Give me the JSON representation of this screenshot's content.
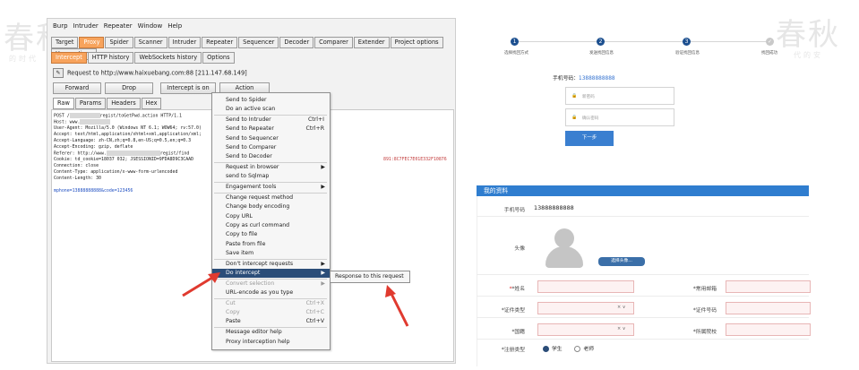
{
  "watermark": {
    "left_big": "春秋",
    "left_small": "的时代",
    "right_big": "春秋",
    "right_small": "代的安"
  },
  "burp": {
    "menu": [
      "Burp",
      "Intruder",
      "Repeater",
      "Window",
      "Help"
    ],
    "main_tabs": [
      "Target",
      "Proxy",
      "Spider",
      "Scanner",
      "Intruder",
      "Repeater",
      "Sequencer",
      "Decoder",
      "Comparer",
      "Extender",
      "Project options",
      "User options"
    ],
    "proxy_tabs": [
      "Intercept",
      "HTTP history",
      "WebSockets history",
      "Options"
    ],
    "request_line": "Request to http://www.haixuebang.com:88  [211.147.68.149]",
    "pencil_icon": "pencil-icon",
    "buttons": {
      "forward": "Forward",
      "drop": "Drop",
      "intercept": "Intercept is on",
      "action": "Action"
    },
    "editor_tabs": [
      "Raw",
      "Params",
      "Headers",
      "Hex"
    ],
    "request_lines": [
      "POST /",
      "Host: www.",
      "User-Agent: Mozilla/5.0 (Windows NT 6.1; WOW64; rv:57.0)",
      "Accept: text/html,application/xhtml+xml,application/xml;",
      "Accept-Language: zh-CN,zh;q=0.8,en-US;q=0.5,en;q=0.3",
      "Accept-Encoding: gzip, deflate",
      "Referer: http://www.",
      "Cookie: td_cookie=18037 032; JSESSIONID=9FDA8D9C3CAAD",
      "Connection: close",
      "Content-Type: application/x-www-form-urlencoded",
      "Content-Length: 30",
      "",
      "mphone=13888888888&code=123456"
    ],
    "request_path": "regist/toGetPwd.action HTTP/1.1",
    "referer_path": "regist/find",
    "cookie_tail": "891:8C7FEC7E01E332F10876"
  },
  "context_menu": [
    {
      "label": "Send to Spider",
      "shortcut": "",
      "arrow": false,
      "disabled": false
    },
    {
      "label": "Do an active scan",
      "shortcut": "",
      "arrow": false,
      "disabled": false
    },
    {
      "label": "Send to Intruder",
      "shortcut": "Ctrl+I",
      "arrow": false,
      "disabled": false
    },
    {
      "label": "Send to Repeater",
      "shortcut": "Ctrl+R",
      "arrow": false,
      "disabled": false
    },
    {
      "label": "Send to Sequencer",
      "shortcut": "",
      "arrow": false,
      "disabled": false
    },
    {
      "label": "Send to Comparer",
      "shortcut": "",
      "arrow": false,
      "disabled": false
    },
    {
      "label": "Send to Decoder",
      "shortcut": "",
      "arrow": false,
      "disabled": false
    },
    {
      "label": "Request in browser",
      "shortcut": "",
      "arrow": true,
      "disabled": false
    },
    {
      "label": "send to Sqlmap",
      "shortcut": "",
      "arrow": false,
      "disabled": false
    },
    {
      "label": "Engagement tools",
      "shortcut": "",
      "arrow": true,
      "disabled": false
    },
    {
      "label": "Change request method",
      "shortcut": "",
      "arrow": false,
      "disabled": false
    },
    {
      "label": "Change body encoding",
      "shortcut": "",
      "arrow": false,
      "disabled": false
    },
    {
      "label": "Copy URL",
      "shortcut": "",
      "arrow": false,
      "disabled": false
    },
    {
      "label": "Copy as curl command",
      "shortcut": "",
      "arrow": false,
      "disabled": false
    },
    {
      "label": "Copy to file",
      "shortcut": "",
      "arrow": false,
      "disabled": false
    },
    {
      "label": "Paste from file",
      "shortcut": "",
      "arrow": false,
      "disabled": false
    },
    {
      "label": "Save item",
      "shortcut": "",
      "arrow": false,
      "disabled": false
    },
    {
      "label": "Don't intercept requests",
      "shortcut": "",
      "arrow": true,
      "disabled": false
    },
    {
      "label": "Do intercept",
      "shortcut": "",
      "arrow": true,
      "disabled": false,
      "highlight": true
    },
    {
      "label": "Convert selection",
      "shortcut": "",
      "arrow": true,
      "disabled": true
    },
    {
      "label": "URL-encode as you type",
      "shortcut": "",
      "arrow": false,
      "disabled": false
    },
    {
      "label": "Cut",
      "shortcut": "Ctrl+X",
      "arrow": false,
      "disabled": true
    },
    {
      "label": "Copy",
      "shortcut": "Ctrl+C",
      "arrow": false,
      "disabled": true
    },
    {
      "label": "Paste",
      "shortcut": "Ctrl+V",
      "arrow": false,
      "disabled": false
    },
    {
      "label": "Message editor help",
      "shortcut": "",
      "arrow": false,
      "disabled": false
    },
    {
      "label": "Proxy interception help",
      "shortcut": "",
      "arrow": false,
      "disabled": false
    }
  ],
  "submenu": {
    "label": "Response to this request"
  },
  "annotation_color": "#e03a2f",
  "reset": {
    "steps": [
      {
        "num": "1",
        "label": "选择找回方式"
      },
      {
        "num": "2",
        "label": "发送找回信息"
      },
      {
        "num": "3",
        "label": "验证找回信息"
      },
      {
        "num": "✓",
        "label": "找回成功"
      }
    ],
    "phone_label": "手机号码：",
    "phone_value": "13888888888",
    "pwd_placeholder": "新密码",
    "confirm_placeholder": "确认密码",
    "next": "下一步"
  },
  "profile": {
    "title": "我的资料",
    "phone_label": "手机号码",
    "phone_value": "13888888888",
    "avatar_label": "头像",
    "choose_avatar": "选择头像...",
    "fields": {
      "name": "*姓名",
      "email": "*常用邮箱",
      "id_type": "*证件类型",
      "id_number": "*证件号码",
      "nationality": "*国籍",
      "school": "*所属院校",
      "reg_type": "*注册类型"
    },
    "reg_options": [
      "学生",
      "老师"
    ],
    "select_suffix": "× ∨"
  }
}
